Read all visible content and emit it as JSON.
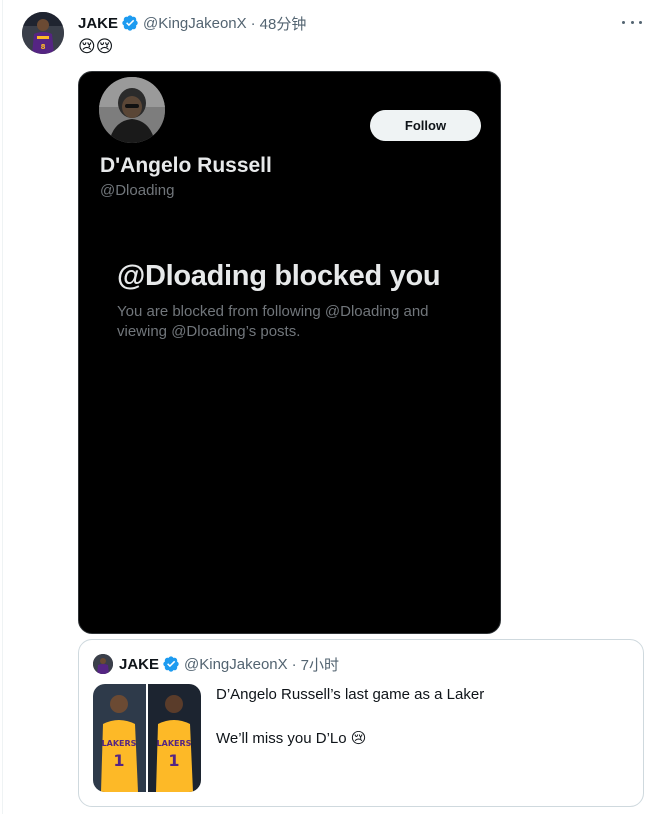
{
  "tweet": {
    "author_name": "JAKE",
    "author_handle": "@KingJakeonX",
    "separator": "·",
    "time": "48分钟",
    "text": "😢😢",
    "verified_color": "#1d9bf0"
  },
  "media_card": {
    "profile_name": "D'Angelo Russell",
    "profile_handle": "@Dloading",
    "follow_label": "Follow",
    "blocked_title": "@Dloading blocked you",
    "blocked_description": "You are blocked from following @Dloading and viewing @Dloading’s posts."
  },
  "quoted_tweet": {
    "author_name": "JAKE",
    "author_handle": "@KingJakeonX",
    "separator": "·",
    "time": "7小时",
    "text_line1": "D’Angelo Russell’s last game as a Laker",
    "text_line2": "We’ll miss you D’Lo 😢"
  },
  "colors": {
    "laker_gold": "#fdb927",
    "laker_purple": "#552583"
  }
}
